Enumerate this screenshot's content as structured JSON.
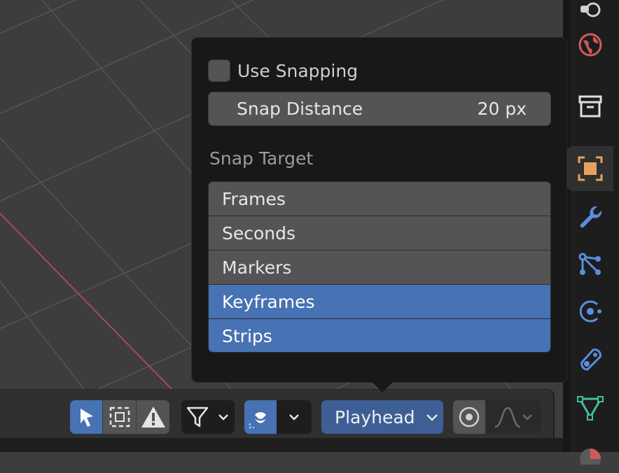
{
  "snapping_popover": {
    "use_snapping_label": "Use Snapping",
    "use_snapping_checked": false,
    "snap_distance_label": "Snap Distance",
    "snap_distance_value": "20 px",
    "snap_target_heading": "Snap Target",
    "snap_targets": [
      {
        "label": "Frames",
        "selected": false
      },
      {
        "label": "Seconds",
        "selected": false
      },
      {
        "label": "Markers",
        "selected": false
      },
      {
        "label": "Keyframes",
        "selected": true
      },
      {
        "label": "Strips",
        "selected": true
      }
    ]
  },
  "header": {
    "playhead_label": "Playhead",
    "icons": [
      "select-tweak-icon",
      "select-box-icon",
      "warning-icon",
      "filter-icon",
      "snap-magnet-icon",
      "proportional-editing-icon",
      "falloff-curve-icon"
    ]
  },
  "sidebar_tabs": [
    "render-icon",
    "world-icon",
    "collection-icon",
    "object-icon",
    "modifier-icon",
    "particles-icon",
    "physics-icon",
    "constraints-icon",
    "object-data-icon",
    "material-icon"
  ],
  "colors": {
    "accent_blue": "#4772b3",
    "playhead_blue": "#3d5f95",
    "popover_bg": "#181818",
    "field_bg": "#545454"
  }
}
